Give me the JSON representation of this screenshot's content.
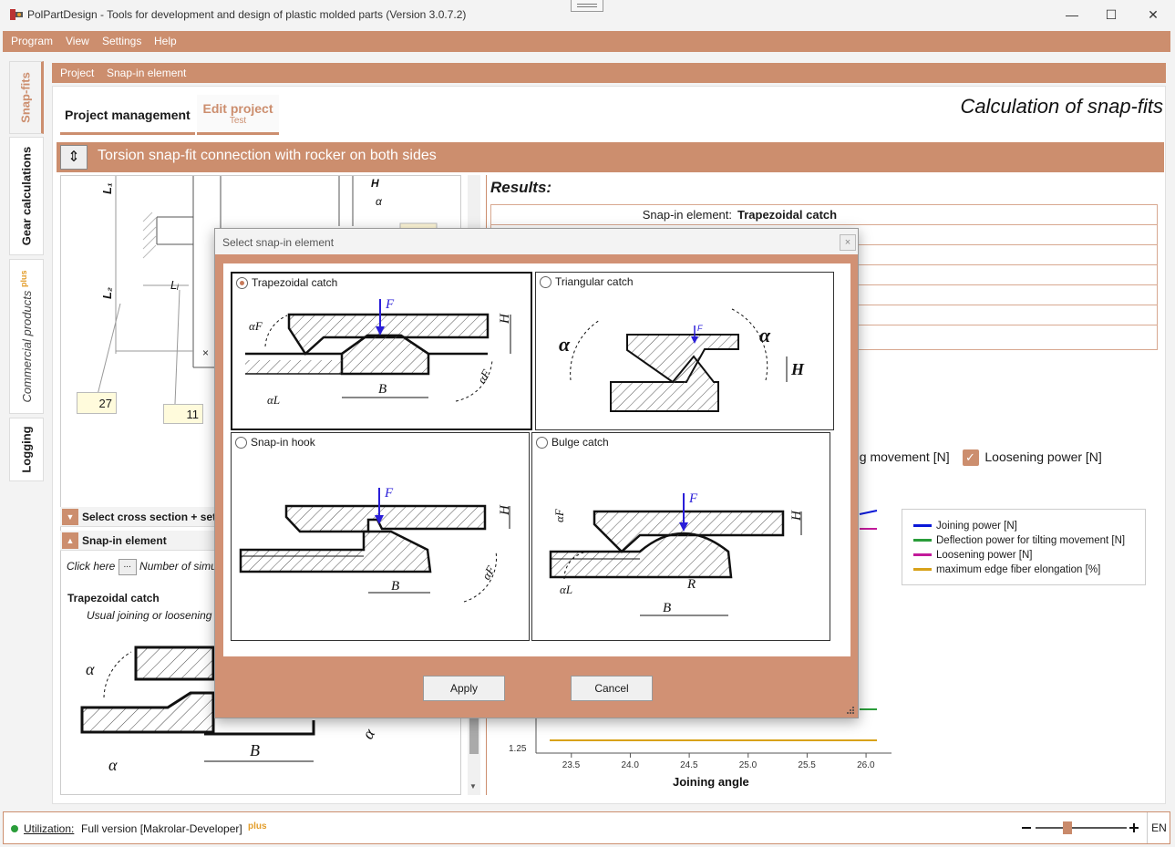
{
  "window": {
    "title": "PolPartDesign - Tools for development and design of plastic molded parts (Version 3.0.7.2)",
    "minimize": "—",
    "maximize": "☐",
    "close": "✕"
  },
  "menu": [
    "Program",
    "View",
    "Settings",
    "Help"
  ],
  "side_tabs": {
    "snapfits": "Snap-fits",
    "gear": "Gear calculations",
    "commercial": "Commercial products",
    "commercial_plus": "plus",
    "logging": "Logging"
  },
  "breadcrumb": [
    "Project",
    "Snap-in element"
  ],
  "tabs": {
    "project_management": "Project management",
    "edit_project": "Edit project",
    "edit_project_sub": "Test"
  },
  "page_title": "Calculation of snap-fits",
  "section_title": "Torsion snap-fit connection with rocker on both sides",
  "drawing": {
    "val1": "27",
    "val2": "11",
    "l1": "L₁",
    "l2": "L₂",
    "li": "Lᵢ",
    "h": "H",
    "af": "α",
    "close_mark": "×"
  },
  "accordion": {
    "cross_section": "Select cross section + set d",
    "snap_in": "Snap-in element"
  },
  "click_row": {
    "prefix": "Click here",
    "button": "...",
    "suffix": "Number of simu"
  },
  "trapezoidal_label": "Trapezoidal catch",
  "usual_label": "Usual joining or loosening",
  "results": {
    "title": "Results:",
    "label": "Snap-in element:",
    "value": "Trapezoidal catch"
  },
  "checkboxes": {
    "tilting": "ng movement [N]",
    "loosening": "Loosening power [N]"
  },
  "legend": [
    {
      "label": "Joining power [N]",
      "color": "#0a18d8"
    },
    {
      "label": "Deflection power for tilting movement [N]",
      "color": "#2a9d3a"
    },
    {
      "label": "Loosening power [N]",
      "color": "#c21a9a"
    },
    {
      "label": "maximum edge fiber elongation [%]",
      "color": "#d8a21a"
    }
  ],
  "chart_data": {
    "type": "line",
    "xlabel": "Joining angle",
    "x_ticks": [
      "23.5",
      "24.0",
      "24.5",
      "25.0",
      "25.5",
      "26.0"
    ],
    "y_tick_visible": "1.25",
    "xlim": [
      23.2,
      26.1
    ]
  },
  "dialog": {
    "title": "Select snap-in element",
    "close": "×",
    "options": [
      {
        "label": "Trapezoidal catch",
        "selected": true
      },
      {
        "label": "Triangular catch",
        "selected": false
      },
      {
        "label": "Snap-in hook",
        "selected": false
      },
      {
        "label": "Bulge catch",
        "selected": false
      }
    ],
    "apply": "Apply",
    "cancel": "Cancel",
    "sym": {
      "F": "F",
      "H": "H",
      "B": "B",
      "R": "R",
      "aF": "αF",
      "aL": "αL"
    }
  },
  "status": {
    "utilization": "Utilization:",
    "version": "Full version [Makrolar-Developer]",
    "plus": "plus",
    "lang": "EN"
  }
}
